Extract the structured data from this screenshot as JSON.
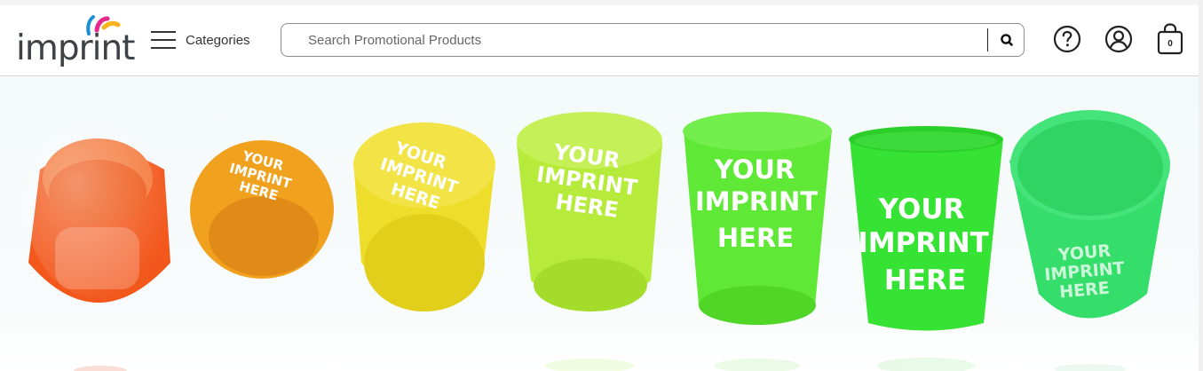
{
  "header": {
    "logo_text": "imprint",
    "categories_label": "Categories",
    "search": {
      "placeholder": "Search Promotional Products",
      "value": ""
    },
    "cart_count": "0"
  },
  "icons": {
    "menu": "hamburger-icon",
    "search": "magnifier-icon",
    "help": "question-circle-icon",
    "account": "user-circle-icon",
    "cart": "shopping-bag-icon"
  },
  "hero": {
    "cup_print": [
      "YOUR",
      "IMPRINT",
      "HERE"
    ],
    "cup_colors": [
      "#f2581c",
      "#f0a21e",
      "#eedd2a",
      "#b6eb3b",
      "#5fe836",
      "#36e233",
      "#35de6a"
    ]
  },
  "colors": {
    "logo_text": "#3d4247",
    "logo_accent_blue": "#1c8fd6",
    "logo_accent_pink": "#e6278b",
    "logo_accent_yellow": "#f7b21c"
  }
}
